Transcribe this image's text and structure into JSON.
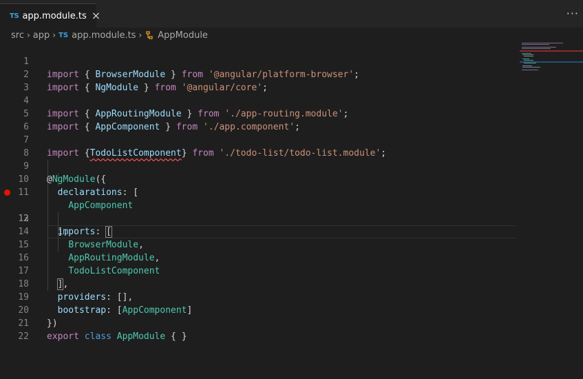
{
  "tab": {
    "badge": "TS",
    "label": "app.module.ts",
    "close": "×"
  },
  "toolbar": {
    "more": "···"
  },
  "breadcrumb": {
    "items": [
      "src",
      "app",
      "app.module.ts",
      "AppModule"
    ],
    "ts_badge": "TS",
    "sep": "›"
  },
  "gutter": {
    "numbers": [
      "1",
      "2",
      "3",
      "4",
      "5",
      "6",
      "7",
      "8",
      "9",
      "10",
      "11",
      "12",
      "13",
      "14",
      "15",
      "16",
      "17",
      "18",
      "19",
      "20",
      "21",
      "22"
    ],
    "breakpoint_line": "12",
    "active_line": "12"
  },
  "code": {
    "l1": [
      "import",
      "{",
      "BrowserModule",
      "}",
      "from",
      "'@angular/platform-browser'",
      ";"
    ],
    "l2": [
      "import",
      "{",
      "NgModule",
      "}",
      "from",
      "'@angular/core'",
      ";"
    ],
    "l4": [
      "import",
      "{",
      "AppRoutingModule",
      "}",
      "from",
      "'./app-routing.module'",
      ";"
    ],
    "l5": [
      "import",
      "{",
      "AppComponent",
      "}",
      "from",
      "'./app.component'",
      ";"
    ],
    "l7": [
      "import",
      "{",
      "TodoListComponent",
      "}",
      "from",
      "'./todo-list/todo-list.module'",
      ";"
    ],
    "l9": [
      "@",
      "NgModule",
      "({"
    ],
    "l10": [
      "declarations",
      ":",
      "["
    ],
    "l11": [
      "AppComponent"
    ],
    "l12": [
      "],"
    ],
    "l13": [
      "imports",
      ":",
      "["
    ],
    "l14": [
      "BrowserModule",
      ","
    ],
    "l15": [
      "AppRoutingModule",
      ","
    ],
    "l16": [
      "TodoListComponent"
    ],
    "l17": [
      "]",
      ","
    ],
    "l18": [
      "providers",
      ":",
      "[],"
    ],
    "l19": [
      "bootstrap",
      ":",
      "[",
      "AppComponent",
      "]"
    ],
    "l20": [
      "})"
    ],
    "l21": [
      "export",
      "class",
      "AppModule",
      "{ }"
    ]
  },
  "colors": {
    "keyword": "#c586c0",
    "string": "#ce9178",
    "type": "#4ec9b0",
    "property": "#9cdcfe",
    "storage": "#569cd6",
    "error": "#f14c4c",
    "breakpoint": "#e51400"
  }
}
